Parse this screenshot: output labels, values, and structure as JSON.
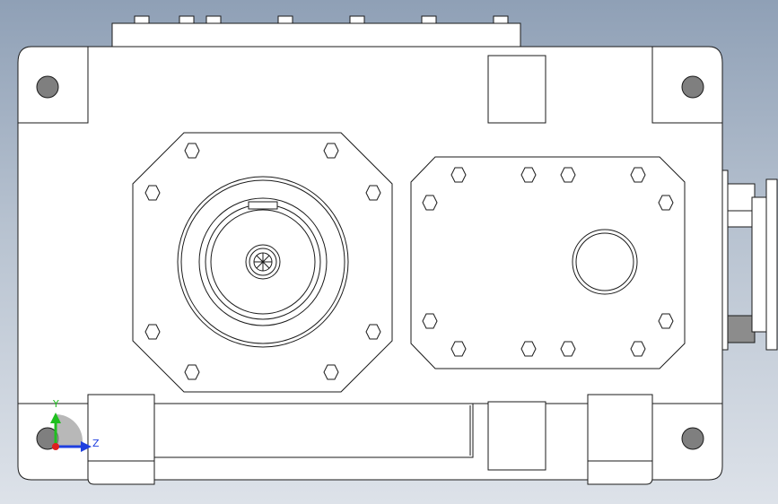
{
  "axis_triad": {
    "y_label": "Y",
    "z_label": "Z",
    "y_color": "#1fbf1f",
    "z_color": "#1f3fdf",
    "origin_color": "#df1f1f"
  },
  "colors": {
    "background_top": "#8fa0b6",
    "background_bottom": "#dde2e9",
    "part_face": "#ffffff",
    "edge": "#1a1a1a",
    "hole_fill": "#7f7f7f"
  }
}
